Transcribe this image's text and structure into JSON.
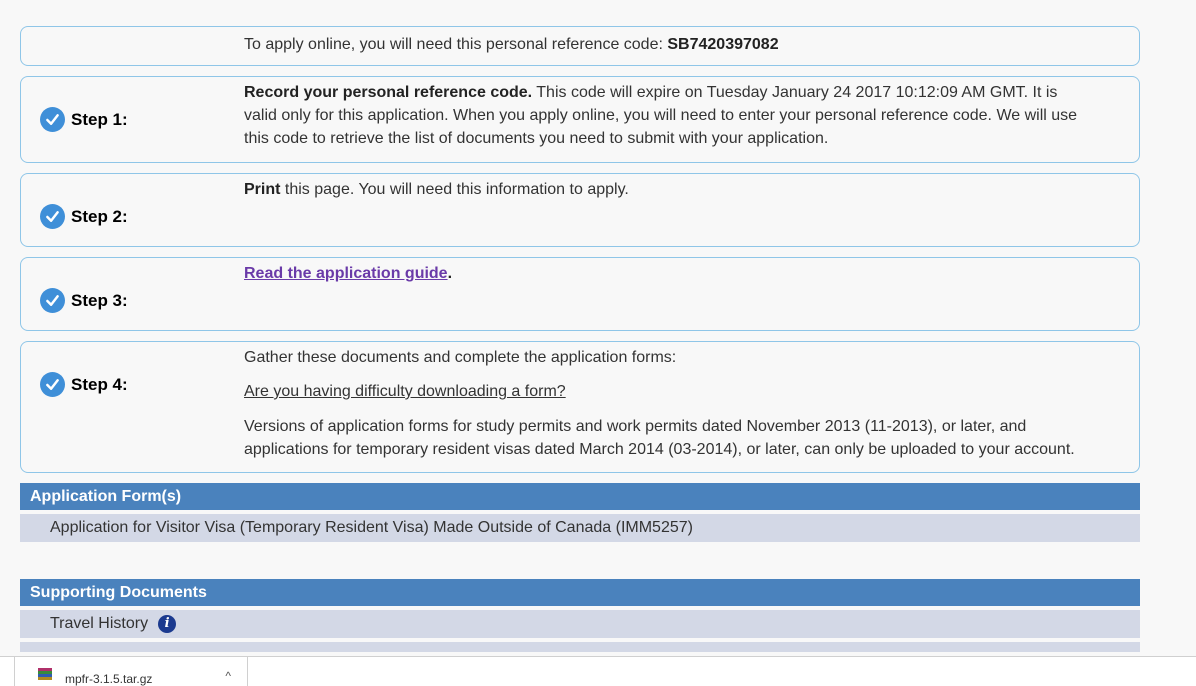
{
  "reference": {
    "text": "To apply online, you will need this personal reference code: ",
    "code": "SB7420397082"
  },
  "steps": [
    {
      "label": "Step 1:",
      "strong": "Record your personal reference code.",
      "text": " This code will expire on Tuesday January 24 2017 10:12:09 AM GMT. It is valid only for this application. When you apply online, you will need to enter your personal reference code. We will use this code to retrieve the list of documents you need to submit with your application."
    },
    {
      "label": "Step 2:",
      "strong": "Print",
      "text": " this page. You will need this information to apply."
    },
    {
      "label": "Step 3:",
      "link": "Read the application guide",
      "after": "."
    },
    {
      "label": "Step 4:",
      "intro": "Gather these documents and complete the application forms:",
      "link": "Are you having difficulty downloading a form?",
      "note": "Versions of application forms for study permits and work permits dated November 2013 (11-2013), or later, and applications for temporary resident visas dated March 2014 (03-2014), or later, can only be uploaded to your account."
    }
  ],
  "application_forms": {
    "header": "Application Form(s)",
    "items": [
      "Application for Visitor Visa (Temporary Resident Visa) Made Outside of Canada (IMM5257)"
    ]
  },
  "supporting_documents": {
    "header": "Supporting Documents",
    "items": [
      "Travel History"
    ]
  },
  "info_icon_glyph": "i",
  "download_bar": {
    "filename": "mpfr-3.1.5.tar.gz",
    "chevron": "^"
  },
  "colors": {
    "panel_border": "#8fc6e8",
    "section_header": "#4a82bd",
    "section_row": "#d3d8e6",
    "check": "#3f8fd8",
    "link": "#6a3aa8"
  }
}
